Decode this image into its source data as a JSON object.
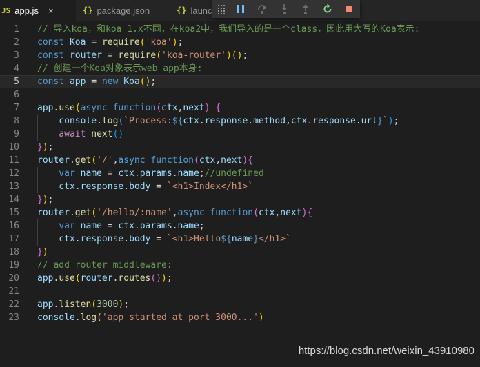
{
  "tabs": [
    {
      "icon": "JS",
      "label": "app.js",
      "close": "×"
    },
    {
      "icon": "{}",
      "label": "package.json"
    },
    {
      "icon": "{}",
      "label": "launch"
    }
  ],
  "debug_toolbar": [
    "pause",
    "step-over",
    "step-into",
    "step-out",
    "restart",
    "stop"
  ],
  "colors": {
    "keyword": "#569cd6",
    "variable": "#9cdcfe",
    "function": "#dcdcaa",
    "string": "#ce9178",
    "comment": "#6a9955",
    "number": "#b5cea8",
    "control": "#c586c0"
  },
  "current_line": 5,
  "code_lines": [
    {
      "n": "1",
      "tokens": [
        {
          "t": "// 导入koa，和koa 1.x不同，在koa2中，我们导入的是一个class，因此用大写的Koa表示:",
          "c": "c"
        }
      ]
    },
    {
      "n": "2",
      "tokens": [
        {
          "t": "const ",
          "c": "k"
        },
        {
          "t": "Koa",
          "c": "v"
        },
        {
          "t": " = ",
          "c": "p"
        },
        {
          "t": "require",
          "c": "f"
        },
        {
          "t": "(",
          "c": "b1"
        },
        {
          "t": "'koa'",
          "c": "s"
        },
        {
          "t": ")",
          "c": "b1"
        },
        {
          "t": ";",
          "c": "p"
        }
      ]
    },
    {
      "n": "3",
      "tokens": [
        {
          "t": "const ",
          "c": "k"
        },
        {
          "t": "router",
          "c": "v"
        },
        {
          "t": " = ",
          "c": "p"
        },
        {
          "t": "require",
          "c": "f"
        },
        {
          "t": "(",
          "c": "b1"
        },
        {
          "t": "'koa-router'",
          "c": "s"
        },
        {
          "t": ")",
          "c": "b1"
        },
        {
          "t": "(",
          "c": "b1"
        },
        {
          "t": ")",
          "c": "b1"
        },
        {
          "t": ";",
          "c": "p"
        }
      ]
    },
    {
      "n": "4",
      "tokens": [
        {
          "t": "// 创建一个Koa对象表示web app本身:",
          "c": "c"
        }
      ]
    },
    {
      "n": "5",
      "tokens": [
        {
          "t": "const ",
          "c": "k"
        },
        {
          "t": "app",
          "c": "v"
        },
        {
          "t": " = ",
          "c": "p"
        },
        {
          "t": "new ",
          "c": "k"
        },
        {
          "t": "Koa",
          "c": "v"
        },
        {
          "t": "(",
          "c": "b1"
        },
        {
          "t": ")",
          "c": "b1"
        },
        {
          "t": ";",
          "c": "p"
        }
      ]
    },
    {
      "n": "6",
      "tokens": []
    },
    {
      "n": "7",
      "tokens": [
        {
          "t": "app",
          "c": "v"
        },
        {
          "t": ".",
          "c": "p"
        },
        {
          "t": "use",
          "c": "f"
        },
        {
          "t": "(",
          "c": "b1"
        },
        {
          "t": "async ",
          "c": "k"
        },
        {
          "t": "function",
          "c": "k"
        },
        {
          "t": "(",
          "c": "b2"
        },
        {
          "t": "ctx",
          "c": "v"
        },
        {
          "t": ",",
          "c": "p"
        },
        {
          "t": "next",
          "c": "v"
        },
        {
          "t": ")",
          "c": "b2"
        },
        {
          "t": " ",
          "c": "p"
        },
        {
          "t": "{",
          "c": "b2"
        }
      ]
    },
    {
      "n": "8",
      "guide": true,
      "tokens": [
        {
          "t": "    console",
          "c": "v"
        },
        {
          "t": ".",
          "c": "p"
        },
        {
          "t": "log",
          "c": "f"
        },
        {
          "t": "(",
          "c": "b3"
        },
        {
          "t": "`Process:",
          "c": "s"
        },
        {
          "t": "${",
          "c": "k"
        },
        {
          "t": "ctx",
          "c": "v"
        },
        {
          "t": ".",
          "c": "p"
        },
        {
          "t": "response",
          "c": "v"
        },
        {
          "t": ".",
          "c": "p"
        },
        {
          "t": "method",
          "c": "v"
        },
        {
          "t": ",",
          "c": "p"
        },
        {
          "t": "ctx",
          "c": "v"
        },
        {
          "t": ".",
          "c": "p"
        },
        {
          "t": "response",
          "c": "v"
        },
        {
          "t": ".",
          "c": "p"
        },
        {
          "t": "url",
          "c": "v"
        },
        {
          "t": "}",
          "c": "k"
        },
        {
          "t": "`",
          "c": "s"
        },
        {
          "t": ")",
          "c": "b3"
        },
        {
          "t": ";",
          "c": "p"
        }
      ]
    },
    {
      "n": "9",
      "guide": true,
      "tokens": [
        {
          "t": "    await ",
          "c": "ctl"
        },
        {
          "t": "next",
          "c": "f"
        },
        {
          "t": "(",
          "c": "b3"
        },
        {
          "t": ")",
          "c": "b3"
        }
      ]
    },
    {
      "n": "10",
      "tokens": [
        {
          "t": "}",
          "c": "b2"
        },
        {
          "t": ")",
          "c": "b1"
        },
        {
          "t": ";",
          "c": "p"
        }
      ]
    },
    {
      "n": "11",
      "tokens": [
        {
          "t": "router",
          "c": "v"
        },
        {
          "t": ".",
          "c": "p"
        },
        {
          "t": "get",
          "c": "f"
        },
        {
          "t": "(",
          "c": "b1"
        },
        {
          "t": "'/'",
          "c": "s"
        },
        {
          "t": ",",
          "c": "p"
        },
        {
          "t": "async ",
          "c": "k"
        },
        {
          "t": "function",
          "c": "k"
        },
        {
          "t": "(",
          "c": "b2"
        },
        {
          "t": "ctx",
          "c": "v"
        },
        {
          "t": ",",
          "c": "p"
        },
        {
          "t": "next",
          "c": "v"
        },
        {
          "t": ")",
          "c": "b2"
        },
        {
          "t": "{",
          "c": "b2"
        }
      ]
    },
    {
      "n": "12",
      "guide": true,
      "tokens": [
        {
          "t": "    var ",
          "c": "k"
        },
        {
          "t": "name",
          "c": "v"
        },
        {
          "t": " = ",
          "c": "p"
        },
        {
          "t": "ctx",
          "c": "v"
        },
        {
          "t": ".",
          "c": "p"
        },
        {
          "t": "params",
          "c": "v"
        },
        {
          "t": ".",
          "c": "p"
        },
        {
          "t": "name",
          "c": "v"
        },
        {
          "t": ";",
          "c": "p"
        },
        {
          "t": "//undefined",
          "c": "c"
        }
      ]
    },
    {
      "n": "13",
      "guide": true,
      "tokens": [
        {
          "t": "    ctx",
          "c": "v"
        },
        {
          "t": ".",
          "c": "p"
        },
        {
          "t": "response",
          "c": "v"
        },
        {
          "t": ".",
          "c": "p"
        },
        {
          "t": "body",
          "c": "v"
        },
        {
          "t": " = ",
          "c": "p"
        },
        {
          "t": "`<h1>Index</h1>`",
          "c": "s"
        }
      ]
    },
    {
      "n": "14",
      "tokens": [
        {
          "t": "}",
          "c": "b2"
        },
        {
          "t": ")",
          "c": "b1"
        },
        {
          "t": ";",
          "c": "p"
        }
      ]
    },
    {
      "n": "15",
      "tokens": [
        {
          "t": "router",
          "c": "v"
        },
        {
          "t": ".",
          "c": "p"
        },
        {
          "t": "get",
          "c": "f"
        },
        {
          "t": "(",
          "c": "b1"
        },
        {
          "t": "'/hello/:name'",
          "c": "s"
        },
        {
          "t": ",",
          "c": "p"
        },
        {
          "t": "async ",
          "c": "k"
        },
        {
          "t": "function",
          "c": "k"
        },
        {
          "t": "(",
          "c": "b2"
        },
        {
          "t": "ctx",
          "c": "v"
        },
        {
          "t": ",",
          "c": "p"
        },
        {
          "t": "next",
          "c": "v"
        },
        {
          "t": ")",
          "c": "b2"
        },
        {
          "t": "{",
          "c": "b2"
        }
      ]
    },
    {
      "n": "16",
      "guide": true,
      "tokens": [
        {
          "t": "    var ",
          "c": "k"
        },
        {
          "t": "name",
          "c": "v"
        },
        {
          "t": " = ",
          "c": "p"
        },
        {
          "t": "ctx",
          "c": "v"
        },
        {
          "t": ".",
          "c": "p"
        },
        {
          "t": "params",
          "c": "v"
        },
        {
          "t": ".",
          "c": "p"
        },
        {
          "t": "name",
          "c": "v"
        },
        {
          "t": ";",
          "c": "p"
        }
      ]
    },
    {
      "n": "17",
      "guide": true,
      "tokens": [
        {
          "t": "    ctx",
          "c": "v"
        },
        {
          "t": ".",
          "c": "p"
        },
        {
          "t": "response",
          "c": "v"
        },
        {
          "t": ".",
          "c": "p"
        },
        {
          "t": "body",
          "c": "v"
        },
        {
          "t": " = ",
          "c": "p"
        },
        {
          "t": "`<h1>Hello",
          "c": "s"
        },
        {
          "t": "${",
          "c": "k"
        },
        {
          "t": "name",
          "c": "v"
        },
        {
          "t": "}",
          "c": "k"
        },
        {
          "t": "</h1>`",
          "c": "s"
        }
      ]
    },
    {
      "n": "18",
      "tokens": [
        {
          "t": "}",
          "c": "b2"
        },
        {
          "t": ")",
          "c": "b1"
        }
      ]
    },
    {
      "n": "19",
      "tokens": [
        {
          "t": "// add router middleware:",
          "c": "c"
        }
      ]
    },
    {
      "n": "20",
      "tokens": [
        {
          "t": "app",
          "c": "v"
        },
        {
          "t": ".",
          "c": "p"
        },
        {
          "t": "use",
          "c": "f"
        },
        {
          "t": "(",
          "c": "b1"
        },
        {
          "t": "router",
          "c": "v"
        },
        {
          "t": ".",
          "c": "p"
        },
        {
          "t": "routes",
          "c": "f"
        },
        {
          "t": "(",
          "c": "b2"
        },
        {
          "t": ")",
          "c": "b2"
        },
        {
          "t": ")",
          "c": "b1"
        },
        {
          "t": ";",
          "c": "p"
        }
      ]
    },
    {
      "n": "21",
      "tokens": []
    },
    {
      "n": "22",
      "tokens": [
        {
          "t": "app",
          "c": "v"
        },
        {
          "t": ".",
          "c": "p"
        },
        {
          "t": "listen",
          "c": "f"
        },
        {
          "t": "(",
          "c": "b1"
        },
        {
          "t": "3000",
          "c": "n"
        },
        {
          "t": ")",
          "c": "b1"
        },
        {
          "t": ";",
          "c": "p"
        }
      ]
    },
    {
      "n": "23",
      "tokens": [
        {
          "t": "console",
          "c": "v"
        },
        {
          "t": ".",
          "c": "p"
        },
        {
          "t": "log",
          "c": "f"
        },
        {
          "t": "(",
          "c": "b1"
        },
        {
          "t": "'app started at port 3000...'",
          "c": "s"
        },
        {
          "t": ")",
          "c": "b1"
        }
      ]
    }
  ],
  "watermark": "https://blog.csdn.net/weixin_43910980"
}
